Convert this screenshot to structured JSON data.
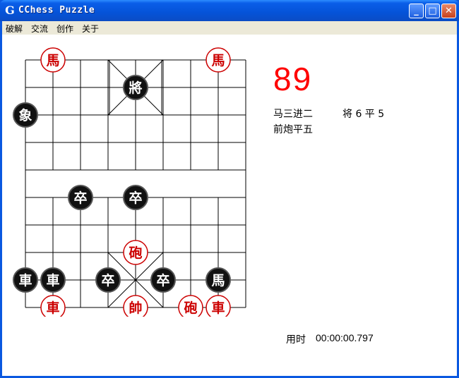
{
  "window": {
    "title": "CChess Puzzle",
    "icon": "G",
    "minimize": "_",
    "maximize": "□",
    "close": "✕"
  },
  "menu": [
    "破解",
    "交流",
    "创作",
    "关于"
  ],
  "puzzle_number": "89",
  "moves": {
    "line1_red": "马三进二",
    "line1_black": "将 6 平 5",
    "line2_red": "前炮平五"
  },
  "timer": {
    "label": "用时",
    "value": "00:00:00.797"
  },
  "board": {
    "cols": 9,
    "rows": 10,
    "pieces": [
      {
        "name": "red-horse-1",
        "text": "馬",
        "side": "red",
        "col": 1,
        "row": 0
      },
      {
        "name": "red-horse-2",
        "text": "馬",
        "side": "red",
        "col": 7,
        "row": 0
      },
      {
        "name": "black-general",
        "text": "將",
        "side": "black",
        "col": 4,
        "row": 1
      },
      {
        "name": "black-elephant",
        "text": "象",
        "side": "black",
        "col": 0,
        "row": 2
      },
      {
        "name": "black-pawn-1",
        "text": "卒",
        "side": "black",
        "col": 2,
        "row": 5
      },
      {
        "name": "black-pawn-2",
        "text": "卒",
        "side": "black",
        "col": 4,
        "row": 5
      },
      {
        "name": "red-cannon-1",
        "text": "砲",
        "side": "red",
        "col": 4,
        "row": 7
      },
      {
        "name": "black-chariot-1",
        "text": "車",
        "side": "black",
        "col": 0,
        "row": 8
      },
      {
        "name": "black-chariot-2",
        "text": "車",
        "side": "black",
        "col": 1,
        "row": 8
      },
      {
        "name": "black-pawn-3",
        "text": "卒",
        "side": "black",
        "col": 3,
        "row": 8
      },
      {
        "name": "black-pawn-4",
        "text": "卒",
        "side": "black",
        "col": 5,
        "row": 8
      },
      {
        "name": "black-horse",
        "text": "馬",
        "side": "black",
        "col": 7,
        "row": 8
      },
      {
        "name": "red-chariot-1",
        "text": "車",
        "side": "red",
        "col": 1,
        "row": 9
      },
      {
        "name": "red-king",
        "text": "帥",
        "side": "red",
        "col": 4,
        "row": 9
      },
      {
        "name": "red-cannon-2",
        "text": "砲",
        "side": "red",
        "col": 6,
        "row": 9
      },
      {
        "name": "red-chariot-2",
        "text": "車",
        "side": "red",
        "col": 7,
        "row": 9
      }
    ]
  },
  "colors": {
    "red_piece": "#cc0000",
    "black_piece": "#000000",
    "puzzle_number": "#ff0000"
  }
}
